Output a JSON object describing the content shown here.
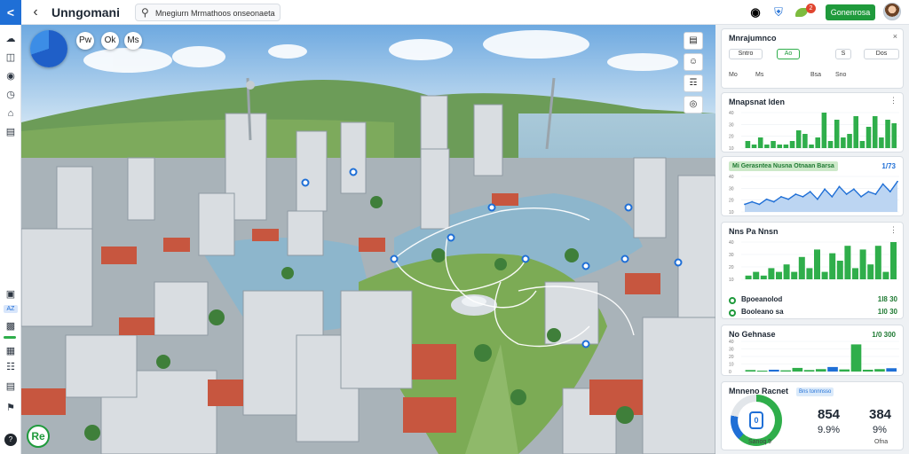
{
  "header": {
    "brand_glyph": "<",
    "back_glyph": "‹",
    "title": "Unngomani",
    "search_value": "Mnegiurn Mrmathoos onseonaeta",
    "search_icon": "search-icon",
    "icons": [
      "notification-icon",
      "shield-icon"
    ],
    "notify_badge": "2",
    "primary_button": "Gonenrosa",
    "accent": "#1f9a3c"
  },
  "left_rail": {
    "items": [
      "cloud-icon",
      "map-icon",
      "layers-icon",
      "clock-icon",
      "home-icon",
      "document-icon"
    ],
    "lower_items": [
      "save-icon",
      "chart-icon",
      "grid-icon",
      "flag-icon",
      "book-icon"
    ],
    "chip_label": "AZ"
  },
  "map": {
    "toolbar": [
      "Pw",
      "Ok",
      "Ms"
    ],
    "tools": [
      "layers-icon",
      "smile-icon",
      "note-icon",
      "location-icon"
    ],
    "fab": "Re",
    "colors": {
      "water": "#8ab4cf",
      "park": "#7cab55",
      "roof": "#c7563f"
    }
  },
  "panel": {
    "card1": {
      "title": "Mnrajumnco",
      "chips": [
        "Sntro",
        "Ao",
        "S",
        "Dos"
      ],
      "chip_active": 1,
      "row2": [
        "Mo",
        "Ms",
        "Bsa",
        "Sno"
      ]
    },
    "card2": {
      "title": "Mnapsnat lden",
      "axis": [
        "40",
        "30",
        "20",
        "10"
      ],
      "values": [
        2,
        1,
        3,
        1,
        2,
        1,
        1,
        2,
        5,
        4,
        1,
        3,
        10,
        2,
        8,
        3,
        4,
        9,
        2,
        6,
        9,
        3,
        8,
        7
      ],
      "max": 10
    },
    "card3": {
      "legend": "Mi Gerasntea Nusna Otnaan Barsa",
      "value": "1/73",
      "axis": [
        "40",
        "30",
        "20",
        "10"
      ],
      "series": [
        3,
        4,
        3,
        5,
        4,
        6,
        5,
        7,
        6,
        8,
        5,
        9,
        6,
        10,
        7,
        9,
        6,
        8,
        7,
        11,
        8,
        12
      ],
      "max": 14
    },
    "card4": {
      "title": "Nns Pa Nnsn",
      "axis": [
        "40",
        "30",
        "20",
        "10"
      ],
      "values": [
        1,
        2,
        1,
        3,
        2,
        4,
        2,
        6,
        3,
        8,
        2,
        7,
        5,
        9,
        3,
        8,
        4,
        9,
        2,
        10
      ],
      "max": 10,
      "rows": [
        {
          "label": "Bpoeanolod",
          "value": "1l8 30"
        },
        {
          "label": "Booleano sa",
          "value": "1l0 30"
        }
      ]
    },
    "card5": {
      "title": "No Gehnase",
      "value": "1/0 300",
      "axis": [
        "40",
        "30",
        "20",
        "10",
        "0"
      ],
      "values": [
        0.5,
        0.3,
        0.6,
        0.4,
        1.2,
        0.5,
        0.8,
        1.5,
        0.7,
        9,
        0.6,
        0.8,
        1.1
      ],
      "max": 10
    },
    "card6": {
      "title": "Mnneno Racnet",
      "tag": "Bns tonnnsso",
      "gauge_caption": "Sanoq 9",
      "stat_a": "854",
      "stat_a_pct": "9.9%",
      "stat_b": "384",
      "stat_b_pct": "9%",
      "stat_b_caption": "Ofna",
      "gauge_fraction": 0.62
    }
  }
}
